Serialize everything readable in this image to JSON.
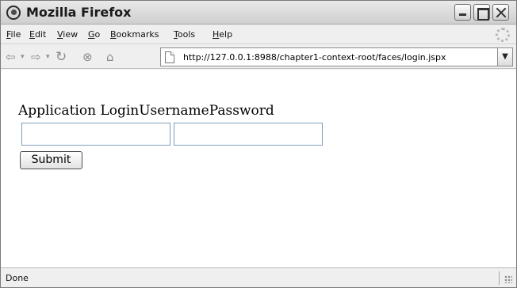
{
  "window": {
    "title": "Mozilla Firefox"
  },
  "menu": {
    "items": [
      {
        "pre": "",
        "ul": "F",
        "post": "ile"
      },
      {
        "pre": "",
        "ul": "E",
        "post": "dit"
      },
      {
        "pre": "",
        "ul": "V",
        "post": "iew"
      },
      {
        "pre": "",
        "ul": "G",
        "post": "o"
      },
      {
        "pre": "",
        "ul": "B",
        "post": "ookmarks"
      },
      {
        "pre": "",
        "ul": "T",
        "post": "ools"
      },
      {
        "pre": "",
        "ul": "H",
        "post": "elp"
      }
    ]
  },
  "navigation": {
    "url": "http://127.0.0.1:8988/chapter1-context-root/faces/login.jspx"
  },
  "page": {
    "heading": "Application LoginUsernamePassword",
    "username_value": "",
    "password_value": "",
    "submit_label": "Submit"
  },
  "status": {
    "text": "Done"
  }
}
